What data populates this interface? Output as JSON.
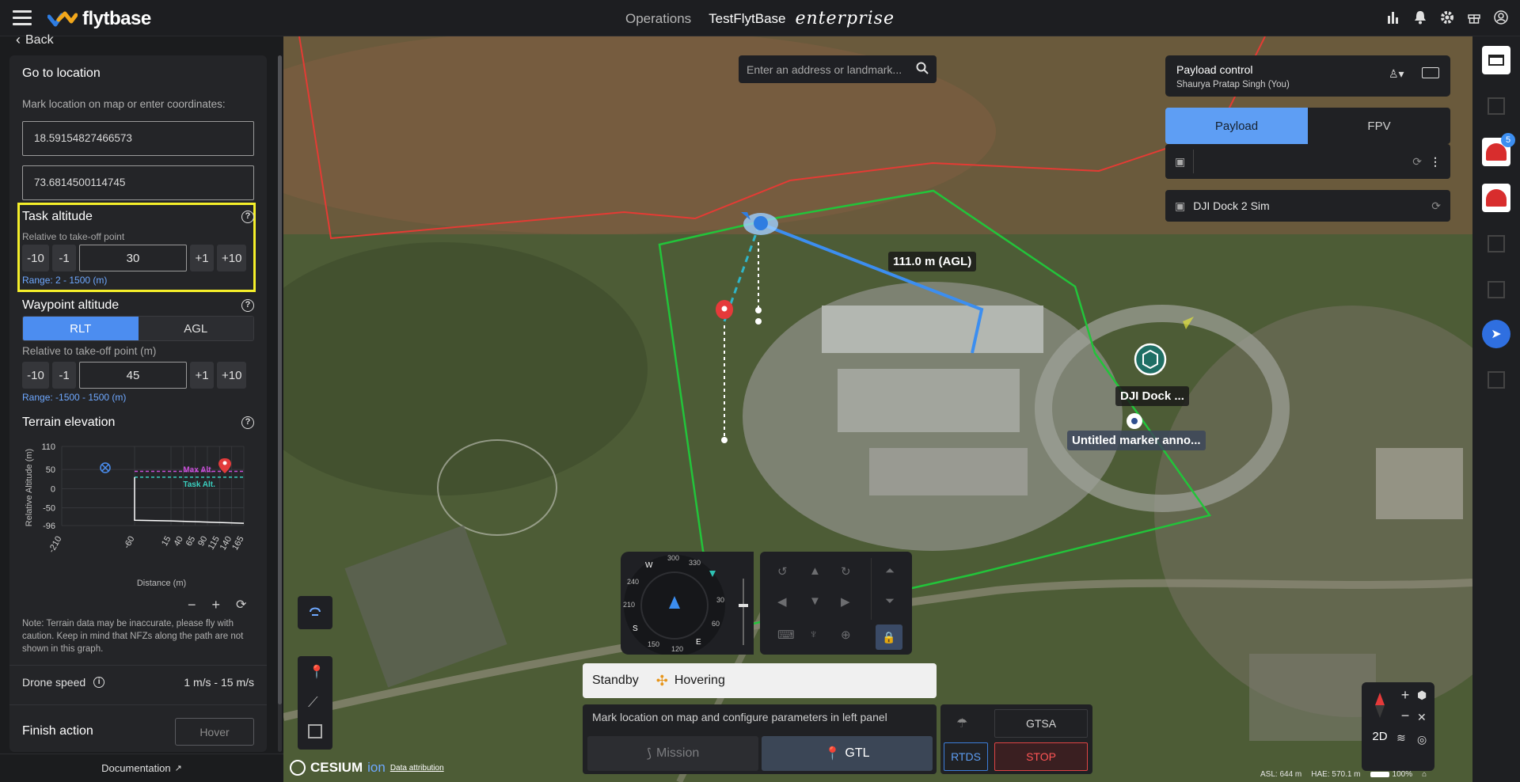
{
  "header": {
    "logo_text": "flytbase",
    "nav_operations": "Operations",
    "org_name": "TestFlytBase",
    "edition": "enterprise",
    "icons": [
      "bar-chart-icon",
      "bell-icon",
      "gear-icon",
      "gift-icon",
      "account-icon"
    ]
  },
  "left_panel": {
    "back_label": "Back",
    "title": "Go to location",
    "instruction": "Mark location on map or enter coordinates:",
    "latitude": "18.59154827466573",
    "longitude": "73.6814500114745",
    "task_altitude": {
      "title": "Task altitude",
      "subtitle": "Relative to take-off point",
      "minus10": "-10",
      "minus1": "-1",
      "value": "30",
      "plus1": "+1",
      "plus10": "+10",
      "range": "Range: 2 - 1500 (m)"
    },
    "waypoint_altitude": {
      "title": "Waypoint altitude",
      "mode_rlt": "RLT",
      "mode_agl": "AGL",
      "selected": "RLT",
      "subtitle": "Relative to take-off point (m)",
      "minus10": "-10",
      "minus1": "-1",
      "value": "45",
      "plus1": "+1",
      "plus10": "+10",
      "range": "Range: -1500 - 1500 (m)"
    },
    "terrain": {
      "title": "Terrain elevation",
      "note": "Note: Terrain data may be inaccurate, please fly with caution. Keep in mind that NFZs along the path are not shown in this graph."
    },
    "drone_speed_label": "Drone speed",
    "drone_speed_value": "1 m/s - 15 m/s",
    "finish_action_label": "Finish action",
    "finish_action_value": "Hover",
    "documentation": "Documentation"
  },
  "chart_data": {
    "type": "line",
    "title": "",
    "xlabel": "Distance (m)",
    "ylabel": "Relative Altitude (m)",
    "x_ticks": [
      "-210",
      "-60",
      "15",
      "40",
      "65",
      "90",
      "115",
      "140",
      "165"
    ],
    "y_ticks": [
      "110",
      "50",
      "0",
      "-50",
      "-96"
    ],
    "ylim": [
      -96,
      110
    ],
    "annotations": [
      "Max Alt.",
      "Task Alt."
    ],
    "series": [
      {
        "name": "Max Alt.",
        "color": "#c84fd8",
        "x": [
          -60,
          165
        ],
        "y": [
          45,
          45
        ]
      },
      {
        "name": "Task Alt.",
        "color": "#3ad0c0",
        "x": [
          -60,
          165
        ],
        "y": [
          30,
          30
        ]
      },
      {
        "name": "",
        "color": "#ffffff",
        "x": [
          -60,
          -60,
          15,
          65,
          115,
          140,
          165
        ],
        "y": [
          30,
          -82,
          -84,
          -86,
          -88,
          -89,
          -90
        ]
      }
    ]
  },
  "map": {
    "search_placeholder": "Enter an address or landmark...",
    "payload_control_title": "Payload control",
    "payload_control_user": "Shaurya Pratap Singh (You)",
    "tab_payload": "Payload",
    "tab_fpv": "FPV",
    "dock_name": "DJI Dock 2 Sim",
    "altitude_label": "111.0 m (AGL)",
    "dock_label": "DJI Dock ...",
    "marker_label": "Untitled marker anno...",
    "compass_labels": [
      "300",
      "330",
      "W",
      "240",
      "210",
      "S",
      "150",
      "120",
      "E",
      "60",
      "30"
    ],
    "status_left": "Standby",
    "status_right": "Hovering",
    "instruction": "Mark location on map and configure parameters in left panel",
    "mission_label": "Mission",
    "gtl_label": "GTL",
    "gtsa_label": "GTSA",
    "rtds_label": "RTDS",
    "stop_label": "STOP",
    "cesium_text": "CESIUM",
    "cesium_ion": "ion",
    "data_attribution": "Data attribution",
    "view_mode": "2D",
    "asl": "ASL: 644 m",
    "hae": "HAE: 570.1 m",
    "zoom": "100%",
    "badge_count": "5"
  }
}
